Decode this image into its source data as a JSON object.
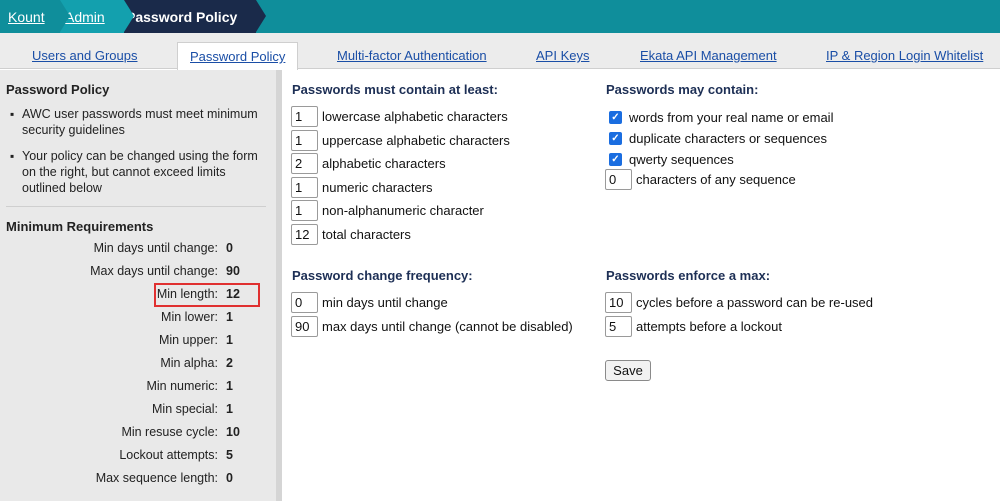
{
  "breadcrumb": {
    "home": "Kount",
    "admin": "Admin",
    "current": "Password Policy"
  },
  "tabs": [
    {
      "label": "Users and Groups"
    },
    {
      "label": "Password Policy",
      "active": true
    },
    {
      "label": "Multi-factor Authentication"
    },
    {
      "label": "API Keys"
    },
    {
      "label": "Ekata API Management"
    },
    {
      "label": "IP & Region Login Whitelist"
    }
  ],
  "sidebar": {
    "title": "Password Policy",
    "bullets": [
      "AWC user passwords must meet minimum security guidelines",
      "Your policy can be changed using the form on the right, but cannot exceed limits outlined below"
    ],
    "min_title": "Minimum Requirements",
    "requirements": [
      {
        "label": "Min days until change:",
        "value": "0"
      },
      {
        "label": "Max days until change:",
        "value": "90"
      },
      {
        "label": "Min length:",
        "value": "12"
      },
      {
        "label": "Min lower:",
        "value": "1"
      },
      {
        "label": "Min upper:",
        "value": "1"
      },
      {
        "label": "Min alpha:",
        "value": "2"
      },
      {
        "label": "Min numeric:",
        "value": "1"
      },
      {
        "label": "Min special:",
        "value": "1"
      },
      {
        "label": "Min resuse cycle:",
        "value": "10"
      },
      {
        "label": "Lockout attempts:",
        "value": "5"
      },
      {
        "label": "Max sequence length:",
        "value": "0"
      }
    ]
  },
  "contain": {
    "title": "Passwords must contain at least:",
    "rows": [
      {
        "value": "1",
        "label": "lowercase alphabetic characters"
      },
      {
        "value": "1",
        "label": "uppercase alphabetic characters"
      },
      {
        "value": "2",
        "label": "alphabetic characters"
      },
      {
        "value": "1",
        "label": "numeric characters"
      },
      {
        "value": "1",
        "label": "non-alphanumeric character"
      },
      {
        "value": "12",
        "label": "total characters"
      }
    ]
  },
  "may_contain": {
    "title": "Passwords may contain:",
    "checks": [
      {
        "label": "words from your real name or email",
        "checked": true
      },
      {
        "label": "duplicate characters or sequences",
        "checked": true
      },
      {
        "label": "qwerty sequences",
        "checked": true
      }
    ],
    "sequence": {
      "value": "0",
      "label": "characters of any sequence"
    }
  },
  "frequency": {
    "title": "Password change frequency:",
    "rows": [
      {
        "value": "0",
        "label": "min days until change"
      },
      {
        "value": "90",
        "label": "max days until change (cannot be disabled)"
      }
    ]
  },
  "enforce": {
    "title": "Passwords enforce a max:",
    "rows": [
      {
        "value": "10",
        "label": "cycles before a password can be re-used"
      },
      {
        "value": "5",
        "label": "attempts before a lockout"
      }
    ]
  },
  "save_label": "Save",
  "colors": {
    "accent": "#0f8e9b",
    "nav_dark": "#1a2a4a",
    "link": "#1a4ea6",
    "highlight": "#e03030"
  }
}
